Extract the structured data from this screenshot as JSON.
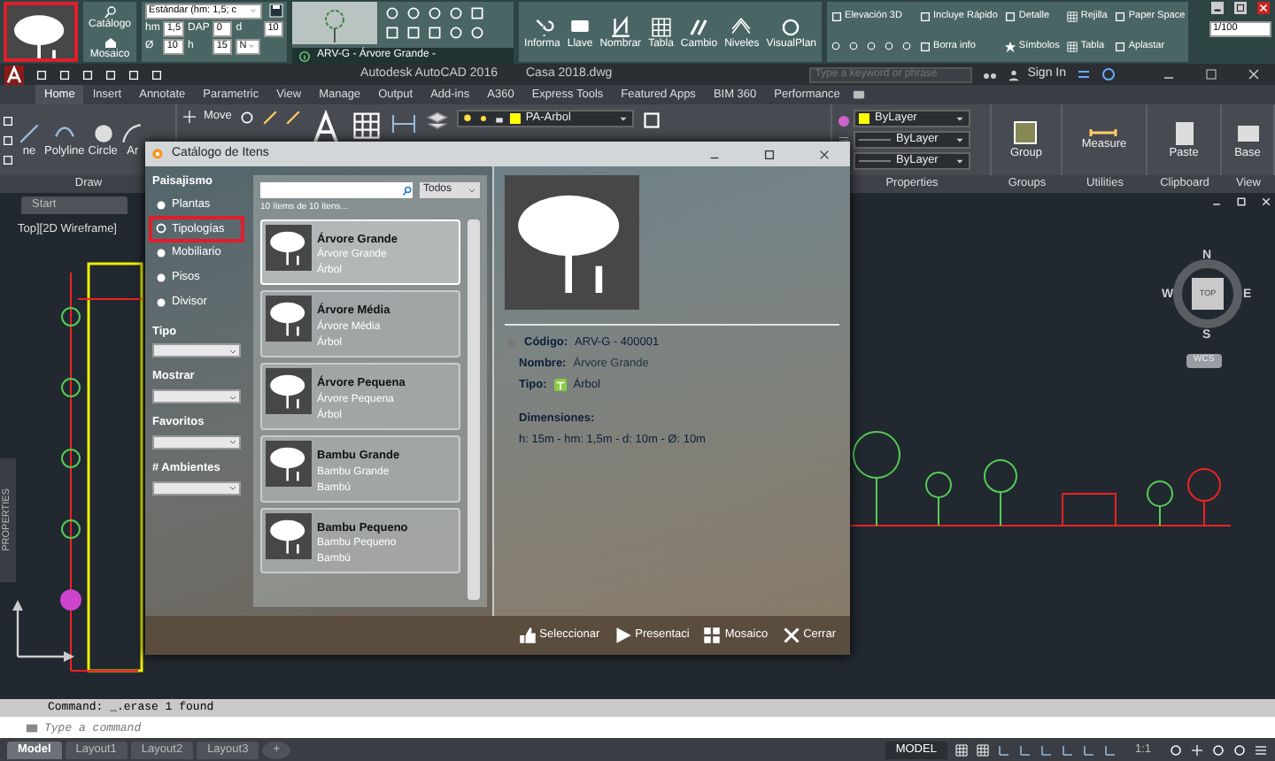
{
  "plugin_toolbar": {
    "buttons": [
      "Catálogo",
      "Mosaico"
    ],
    "style_select": "Estándar (hm: 1,5; c",
    "params": [
      {
        "label": "hm",
        "value": "1,5"
      },
      {
        "label": "DAP",
        "value": "0"
      },
      {
        "label": "d",
        "value": "10"
      },
      {
        "label": "Ø",
        "value": "10"
      },
      {
        "label": "h",
        "value": "15"
      }
    ],
    "direction_select": "N",
    "preview_caption": "ARV-G - Árvore Grande -",
    "tools": [
      "Informa",
      "Llave",
      "Nombrar",
      "Tabla",
      "Cambio",
      "Niveles",
      "VisualPlan"
    ],
    "quick_tools": [
      "Elevación 3D",
      "Incluye Rápido",
      "Detalle",
      "Rejilla",
      "Paper Space",
      "Borra info",
      "Símbolos",
      "Tabla",
      "Aplastar"
    ],
    "scale": "1/100"
  },
  "title_bar": {
    "app": "Autodesk AutoCAD 2016",
    "file": "Casa 2018.dwg",
    "search_placeholder": "Type a keyword or phrase",
    "sign_in": "Sign In"
  },
  "ribbon_tabs": [
    {
      "label": "Home",
      "selected": true
    },
    {
      "label": "Insert",
      "selected": false
    },
    {
      "label": "Annotate",
      "selected": false
    },
    {
      "label": "Parametric",
      "selected": false
    },
    {
      "label": "View",
      "selected": false
    },
    {
      "label": "Manage",
      "selected": false
    },
    {
      "label": "Output",
      "selected": false
    },
    {
      "label": "Add-ins",
      "selected": false
    },
    {
      "label": "A360",
      "selected": false
    },
    {
      "label": "Express Tools",
      "selected": false
    },
    {
      "label": "Featured Apps",
      "selected": false
    },
    {
      "label": "BIM 360",
      "selected": false
    },
    {
      "label": "Performance",
      "selected": false
    }
  ],
  "ribbon": {
    "draw_tools": [
      "ne",
      "Polyline",
      "Circle",
      "Ar"
    ],
    "move": "Move",
    "layer": "PA-Arbol",
    "properties": [
      "ByLayer",
      "ByLayer",
      "ByLayer"
    ],
    "tools": [
      "Group",
      "Measure",
      "Paste",
      "Base"
    ],
    "panels": [
      "Draw",
      "Properties",
      "Groups",
      "Utilities",
      "Clipboard",
      "View"
    ]
  },
  "file_tabs": [
    "Start"
  ],
  "viewport_label": "Top][2D Wireframe]",
  "side_palette": "PROPERTIES",
  "view_cube": {
    "north": "N",
    "south": "S",
    "east": "E",
    "west": "W",
    "face": "TOP",
    "ucs": "WCS"
  },
  "dialog": {
    "title": "Catálogo de Itens",
    "group_title": "Paisajismo",
    "categories": [
      {
        "label": "Plantas",
        "selected": false
      },
      {
        "label": "Tipologías",
        "selected": true
      },
      {
        "label": "Mobiliario",
        "selected": false
      },
      {
        "label": "Pisos",
        "selected": false
      },
      {
        "label": "Divisor",
        "selected": false
      }
    ],
    "filters": [
      "Tipo",
      "Mostrar",
      "Favoritos",
      "# Ambientes"
    ],
    "filter_select": "Todos",
    "count": "10 ítems de 10 ítens...",
    "items": [
      {
        "name": "Árvore Grande",
        "subtitle": "Árvore Grande",
        "type": "Árbol",
        "selected": true
      },
      {
        "name": "Árvore Média",
        "subtitle": "Árvore Média",
        "type": "Árbol",
        "selected": false
      },
      {
        "name": "Árvore Pequena",
        "subtitle": "Árvore Pequena",
        "type": "Árbol",
        "selected": false
      },
      {
        "name": "Bambu Grande",
        "subtitle": "Bambu Grande",
        "type": "Bambú",
        "selected": false
      },
      {
        "name": "Bambu Pequeno",
        "subtitle": "Bambu Pequeno",
        "type": "Bambú",
        "selected": false
      }
    ],
    "details": {
      "code_label": "Código:",
      "code": "ARV-G - 400001",
      "name_label": "Nombre:",
      "name": "Árvore Grande",
      "type_label": "Tipo:",
      "type": "Árbol",
      "dimensions_label": "Dimensiones:",
      "dimensions": "h: 15m - hm: 1,5m - d: 10m - Ø: 10m"
    },
    "actions": [
      "Seleccionar",
      "Presentaci",
      "Mosaico",
      "Cerrar"
    ]
  },
  "command_line": {
    "history": "Command: _.erase 1 found",
    "placeholder": "Type a command"
  },
  "layout_tabs": [
    {
      "label": "Model",
      "selected": true
    },
    {
      "label": "Layout1",
      "selected": false
    },
    {
      "label": "Layout2",
      "selected": false
    },
    {
      "label": "Layout3",
      "selected": false
    }
  ],
  "add_layout": "+",
  "status_bar": {
    "mode": "MODEL",
    "scale": "1:1"
  }
}
